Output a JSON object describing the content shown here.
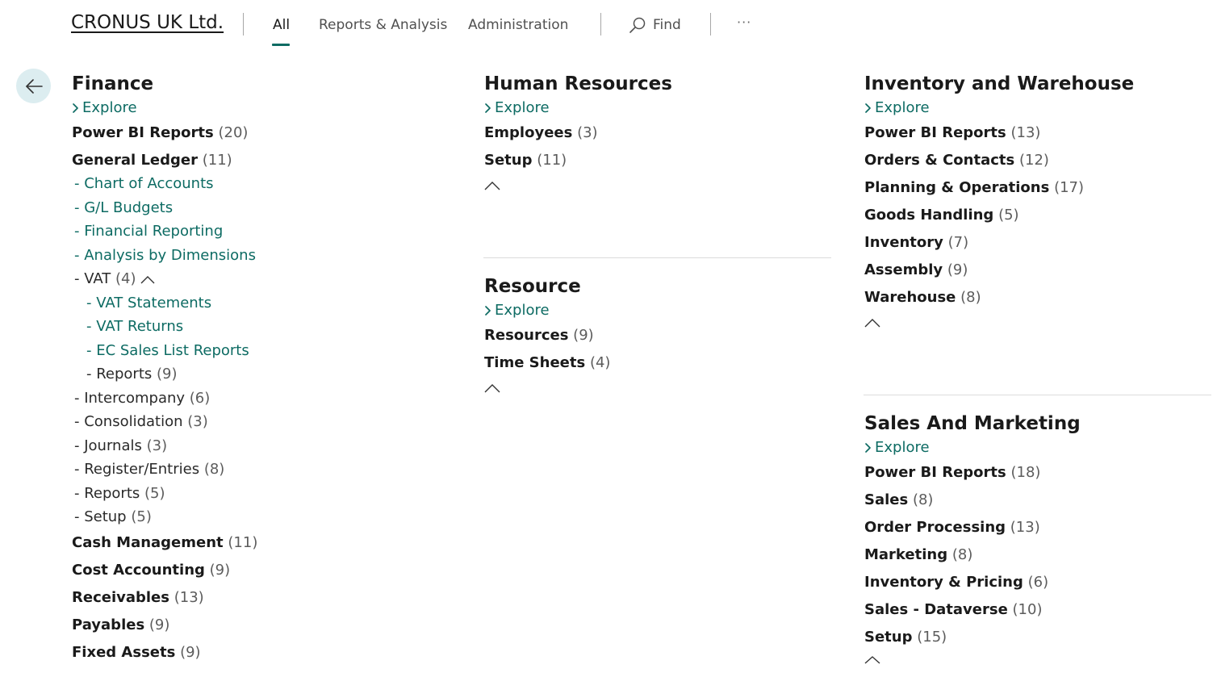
{
  "header": {
    "company": "CRONUS UK Ltd.",
    "tabs": [
      "All",
      "Reports & Analysis",
      "Administration"
    ],
    "find_label": "Find",
    "more_label": "···",
    "accent": "#0d6b63"
  },
  "finance": {
    "title": "Finance",
    "explore": "Explore",
    "items": [
      {
        "label": "Power BI Reports",
        "count": "(20)"
      },
      {
        "label": "General Ledger",
        "count": "(11)"
      }
    ],
    "gl_links": [
      "- Chart of Accounts",
      "- G/L Budgets",
      "- Financial Reporting",
      "- Analysis by Dimensions"
    ],
    "vat": {
      "label": "- VAT",
      "count": "(4)"
    },
    "vat_links": [
      "- VAT Statements",
      "- VAT Returns",
      "- EC Sales List Reports"
    ],
    "vat_reports": {
      "label": "- Reports",
      "count": "(9)"
    },
    "gl_groups": [
      {
        "label": "- Intercompany",
        "count": "(6)"
      },
      {
        "label": "- Consolidation",
        "count": "(3)"
      },
      {
        "label": "- Journals",
        "count": "(3)"
      },
      {
        "label": "- Register/Entries",
        "count": "(8)"
      },
      {
        "label": "- Reports",
        "count": "(5)"
      },
      {
        "label": "- Setup",
        "count": "(5)"
      }
    ],
    "more_items": [
      {
        "label": "Cash Management",
        "count": "(11)"
      },
      {
        "label": "Cost Accounting",
        "count": "(9)"
      },
      {
        "label": "Receivables",
        "count": "(13)"
      },
      {
        "label": "Payables",
        "count": "(9)"
      },
      {
        "label": "Fixed Assets",
        "count": "(9)"
      }
    ]
  },
  "hr": {
    "title": "Human Resources",
    "explore": "Explore",
    "items": [
      {
        "label": "Employees",
        "count": "(3)"
      },
      {
        "label": "Setup",
        "count": "(11)"
      }
    ]
  },
  "resource": {
    "title": "Resource",
    "explore": "Explore",
    "items": [
      {
        "label": "Resources",
        "count": "(9)"
      },
      {
        "label": "Time Sheets",
        "count": "(4)"
      }
    ]
  },
  "inventory": {
    "title": "Inventory and Warehouse",
    "explore": "Explore",
    "items": [
      {
        "label": "Power BI Reports",
        "count": "(13)"
      },
      {
        "label": "Orders & Contacts",
        "count": "(12)"
      },
      {
        "label": "Planning & Operations",
        "count": "(17)"
      },
      {
        "label": "Goods Handling",
        "count": "(5)"
      },
      {
        "label": "Inventory",
        "count": "(7)"
      },
      {
        "label": "Assembly",
        "count": "(9)"
      },
      {
        "label": "Warehouse",
        "count": "(8)"
      }
    ]
  },
  "sales": {
    "title": "Sales And Marketing",
    "explore": "Explore",
    "items": [
      {
        "label": "Power BI Reports",
        "count": "(18)"
      },
      {
        "label": "Sales",
        "count": "(8)"
      },
      {
        "label": "Order Processing",
        "count": "(13)"
      },
      {
        "label": "Marketing",
        "count": "(8)"
      },
      {
        "label": "Inventory & Pricing",
        "count": "(6)"
      },
      {
        "label": "Sales - Dataverse",
        "count": "(10)"
      },
      {
        "label": "Setup",
        "count": "(15)"
      }
    ]
  }
}
